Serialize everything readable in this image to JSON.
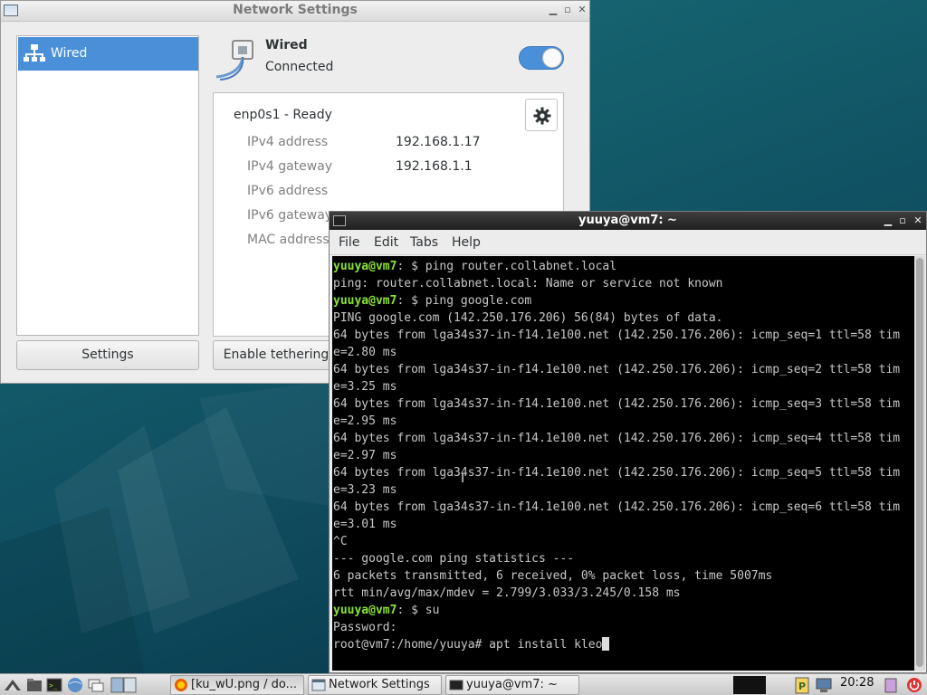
{
  "network_settings": {
    "title": "Network Settings",
    "sidebar_item": "Wired",
    "wired_title": "Wired",
    "wired_status": "Connected",
    "interface_name": "enp0s1 - Ready",
    "properties": [
      {
        "label": "IPv4 address",
        "value": "192.168.1.17"
      },
      {
        "label": "IPv4 gateway",
        "value": "192.168.1.1"
      },
      {
        "label": "IPv6 address",
        "value": ""
      },
      {
        "label": "IPv6 gateway",
        "value": ""
      },
      {
        "label": "MAC address",
        "value": ""
      }
    ],
    "settings_button": "Settings",
    "tethering_button": "Enable tethering",
    "toggle_on": true,
    "accent_color": "#4a90d9"
  },
  "terminal": {
    "title": "yuuya@vm7: ~",
    "menu": [
      "File",
      "Edit",
      "Tabs",
      "Help"
    ],
    "lines": [
      {
        "user": "yuuya@vm7",
        "rest": ": $ ping router.collabnet.local"
      },
      {
        "text": "ping: router.collabnet.local: Name or service not known"
      },
      {
        "user": "yuuya@vm7",
        "rest": ": $ ping google.com"
      },
      {
        "text": "PING google.com (142.250.176.206) 56(84) bytes of data."
      },
      {
        "text": "64 bytes from lga34s37-in-f14.1e100.net (142.250.176.206): icmp_seq=1 ttl=58 tim"
      },
      {
        "text": "e=2.80 ms"
      },
      {
        "text": "64 bytes from lga34s37-in-f14.1e100.net (142.250.176.206): icmp_seq=2 ttl=58 tim"
      },
      {
        "text": "e=3.25 ms"
      },
      {
        "text": "64 bytes from lga34s37-in-f14.1e100.net (142.250.176.206): icmp_seq=3 ttl=58 tim"
      },
      {
        "text": "e=2.95 ms"
      },
      {
        "text": "64 bytes from lga34s37-in-f14.1e100.net (142.250.176.206): icmp_seq=4 ttl=58 tim"
      },
      {
        "text": "e=2.97 ms"
      },
      {
        "text": "64 bytes from lga34s37-in-f14.1e100.net (142.250.176.206): icmp_seq=5 ttl=58 tim"
      },
      {
        "text": "e=3.23 ms"
      },
      {
        "text": "64 bytes from lga34s37-in-f14.1e100.net (142.250.176.206): icmp_seq=6 ttl=58 tim"
      },
      {
        "text": "e=3.01 ms"
      },
      {
        "text": "^C"
      },
      {
        "text": "--- google.com ping statistics ---"
      },
      {
        "text": "6 packets transmitted, 6 received, 0% packet loss, time 5007ms"
      },
      {
        "text": "rtt min/avg/max/mdev = 2.799/3.033/3.245/0.158 ms"
      },
      {
        "user": "yuuya@vm7",
        "rest": ": $ su"
      },
      {
        "text": "Password:"
      },
      {
        "text": "root@vm7:/home/yuuya# apt install kleo",
        "cursor": true
      }
    ],
    "prompt_color": "#8ae234",
    "text_color": "#c7c7c7",
    "background_color": "#000000"
  },
  "taskbar": {
    "buttons": [
      {
        "label": "[ku_wU.png / do...",
        "icon": "firefox-icon"
      },
      {
        "label": "Network Settings",
        "icon": "window-icon"
      },
      {
        "label": "yuuya@vm7: ~",
        "icon": "terminal-icon"
      }
    ],
    "clock": "20:28"
  }
}
